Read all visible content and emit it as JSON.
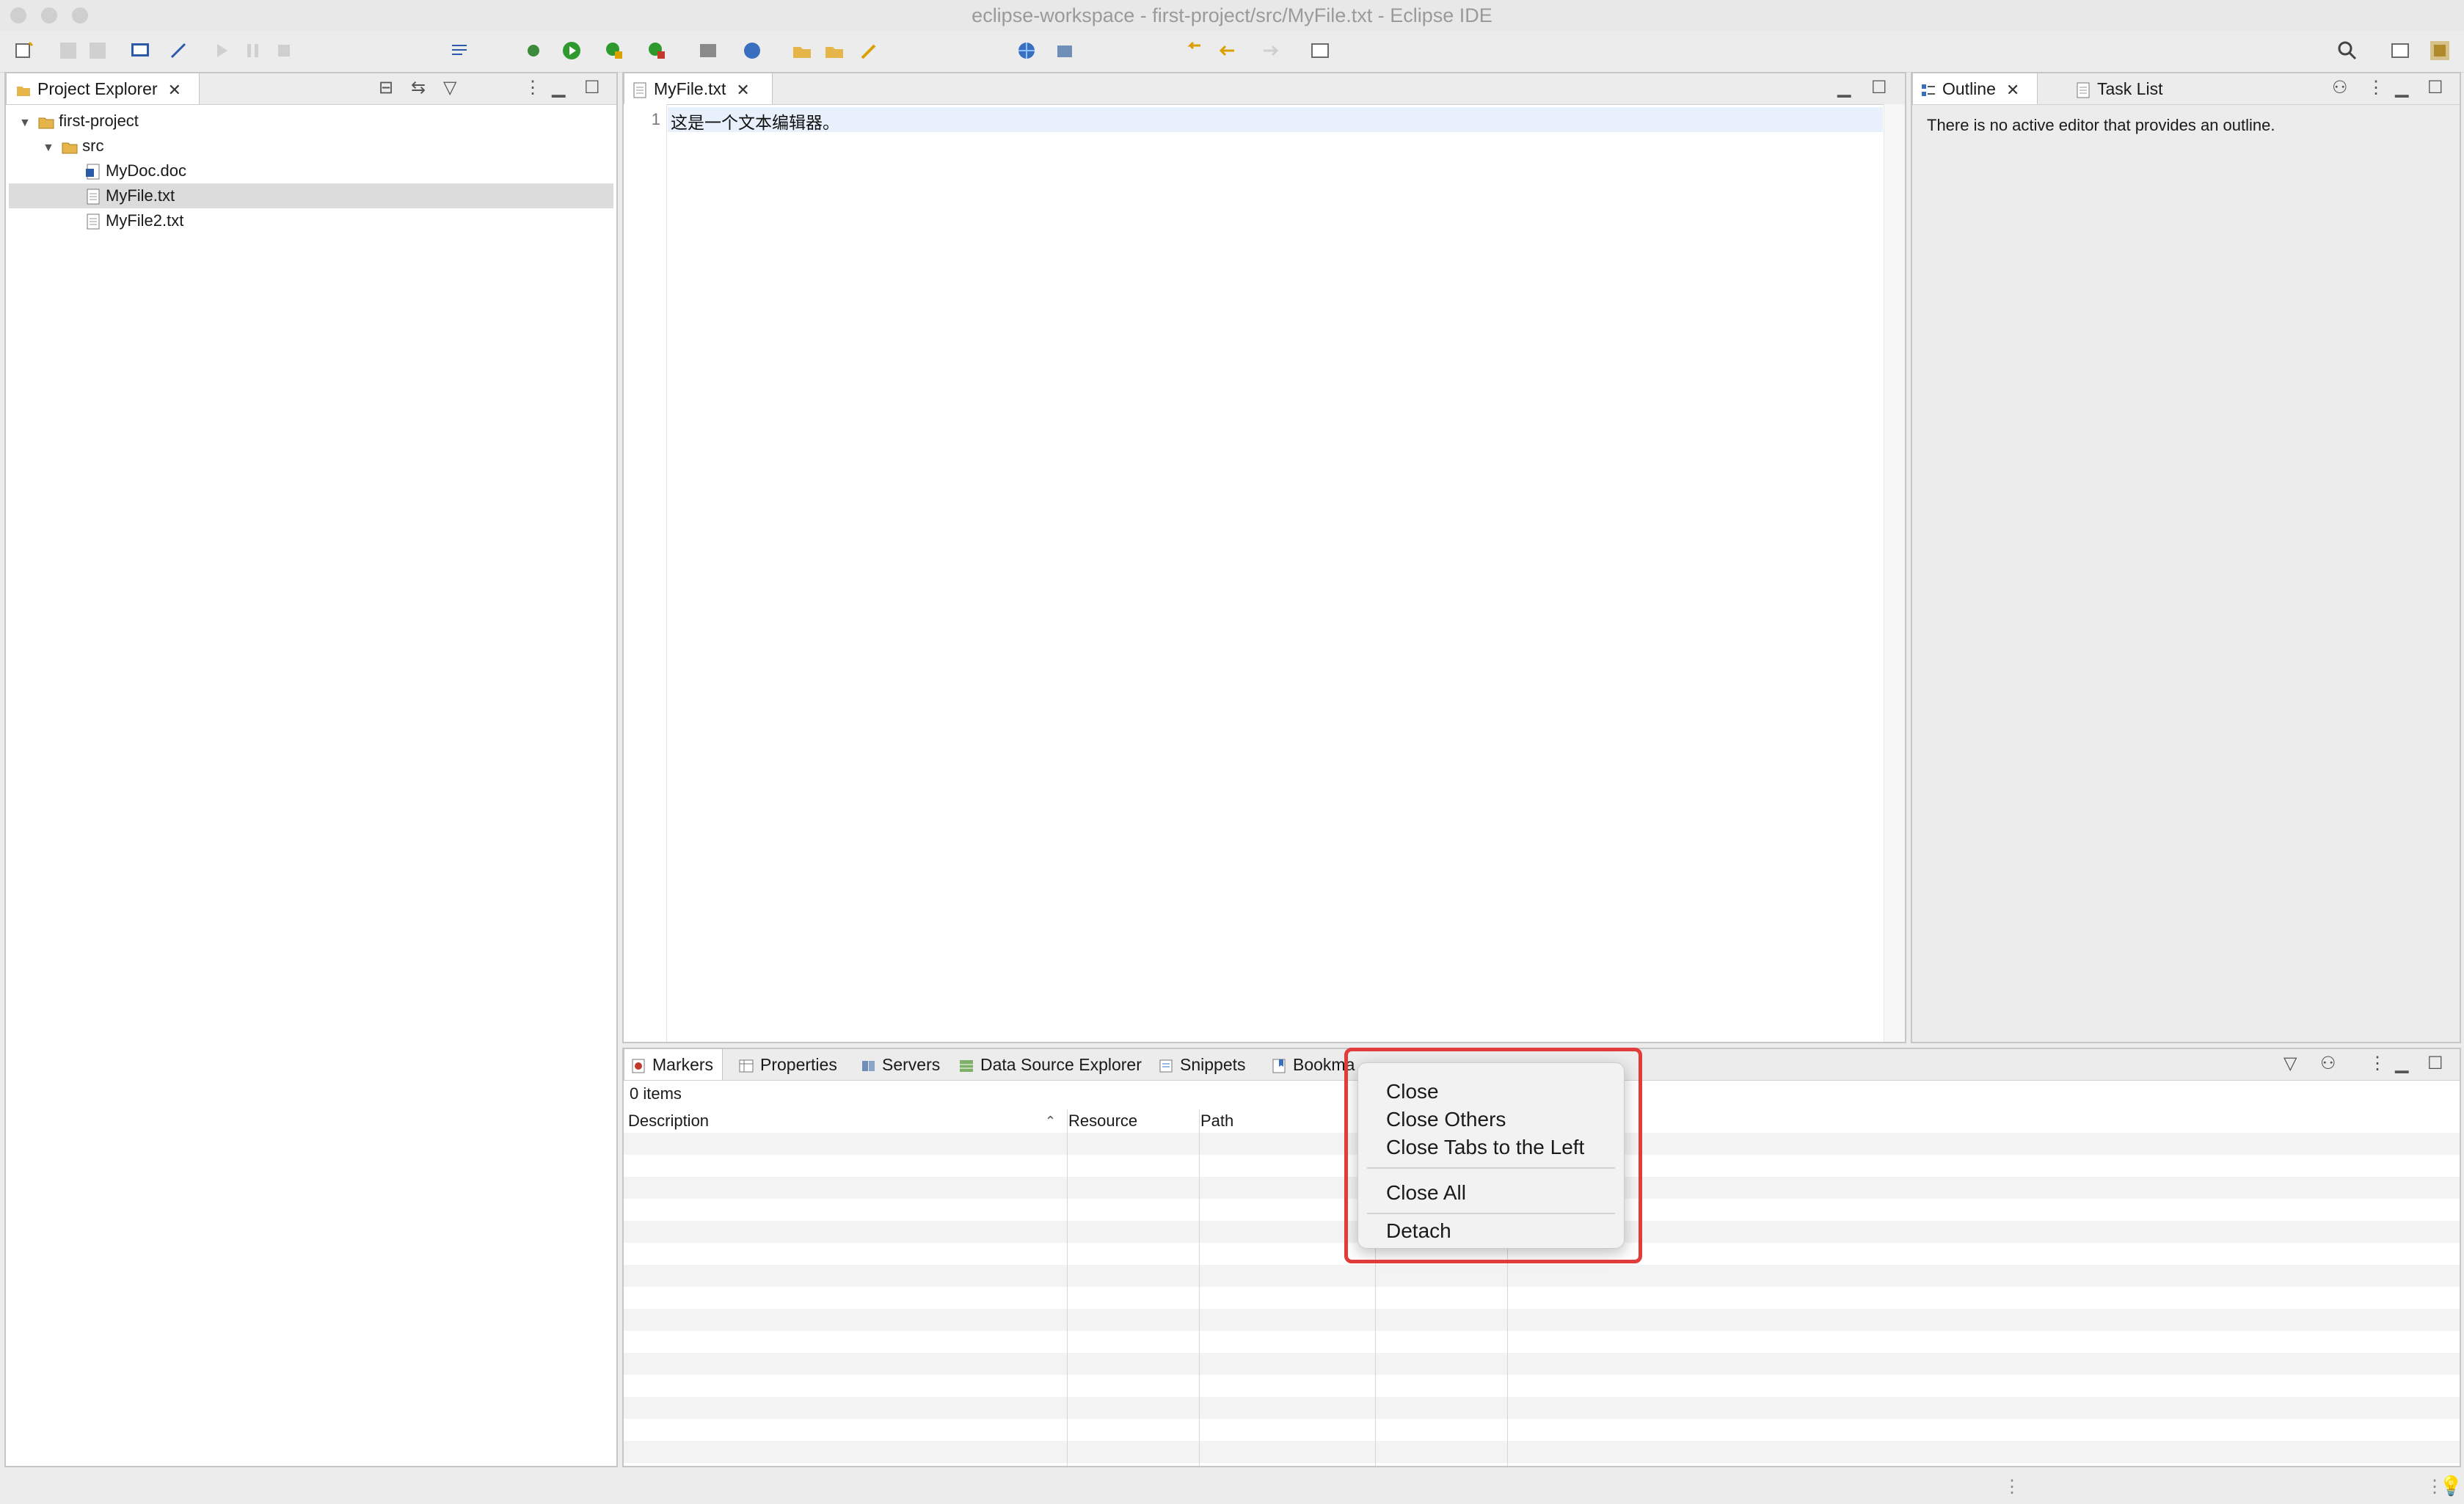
{
  "window": {
    "title": "eclipse-workspace - first-project/src/MyFile.txt - Eclipse IDE"
  },
  "project_explorer": {
    "tab_label": "Project Explorer",
    "tree": [
      {
        "label": "first-project",
        "icon": "project-folder-icon"
      },
      {
        "label": "src",
        "icon": "folder-icon"
      },
      {
        "label": "MyDoc.doc",
        "icon": "word-doc-icon"
      },
      {
        "label": "MyFile.txt",
        "icon": "text-file-icon"
      },
      {
        "label": "MyFile2.txt",
        "icon": "text-file-icon"
      }
    ]
  },
  "editor": {
    "tab_label": "MyFile.txt",
    "line_number": "1",
    "content": "这是一个文本编辑器。"
  },
  "outline": {
    "tabs": [
      "Outline",
      "Task List"
    ],
    "message": "There is no active editor that provides an outline."
  },
  "bottom_panel": {
    "tabs": [
      "Markers",
      "Properties",
      "Servers",
      "Data Source Explorer",
      "Snippets",
      "Bookma"
    ],
    "item_count": "0 items",
    "columns": [
      "Description",
      "Resource",
      "Path"
    ]
  },
  "context_menu": {
    "items": [
      "Close",
      "Close Others",
      "Close Tabs to the Left",
      "Close All",
      "Detach"
    ]
  },
  "colors": {
    "highlight": "#e23b3b",
    "selection": "#dcdcdc",
    "current_line": "#e8f0fb"
  }
}
